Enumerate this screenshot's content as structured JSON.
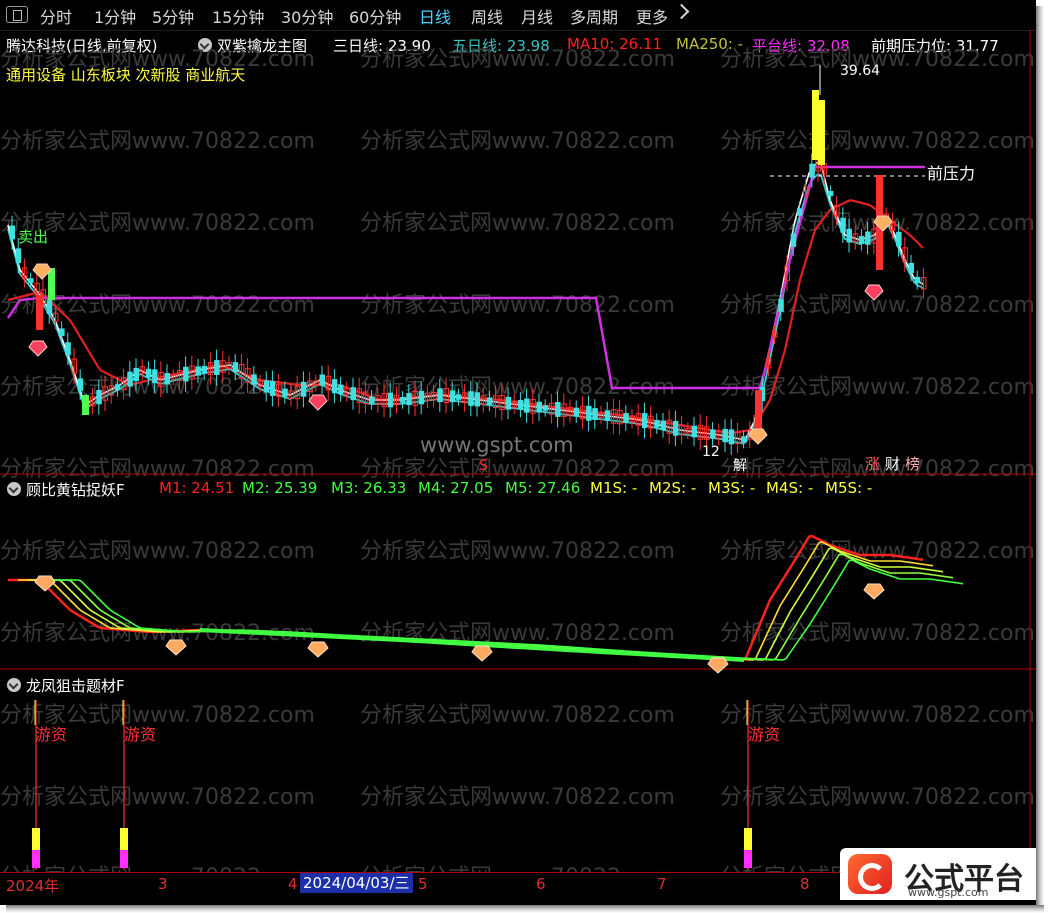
{
  "toolbar": {
    "items": [
      {
        "label": "分时"
      },
      {
        "label": "1分钟"
      },
      {
        "label": "5分钟"
      },
      {
        "label": "15分钟"
      },
      {
        "label": "30分钟"
      },
      {
        "label": "60分钟"
      },
      {
        "label": "日线"
      },
      {
        "label": "周线"
      },
      {
        "label": "月线"
      },
      {
        "label": "多周期"
      },
      {
        "label": "更多"
      }
    ],
    "active": "日线"
  },
  "main_panel": {
    "stock_title": "腾达科技(日线,前复权)",
    "indicator_name": "双紫擒龙主图",
    "legend": [
      {
        "label": "三日线: 23.90",
        "color": "#ffffff"
      },
      {
        "label": "五日线: 23.98",
        "color": "#40c0c0"
      },
      {
        "label": "MA10: 26.11",
        "color": "#ff2020"
      },
      {
        "label": "MA250: -",
        "color": "#c0c040"
      },
      {
        "label": "平台线: 32.08",
        "color": "#ff30ff"
      },
      {
        "label": "前期压力位: 31.77",
        "color": "#ffffff"
      }
    ],
    "tags": "通用设备 山东板块 次新股 商业航天",
    "annotations": {
      "high_price": "39.64",
      "low_price": "12",
      "pressure": "前压力",
      "sell": "卖出",
      "jie": "解",
      "s_mark": "S",
      "zhang": "涨",
      "cai": "财",
      "bang": "榜"
    }
  },
  "panel2": {
    "name": "顾比黄钻捉妖F",
    "legend": [
      {
        "label": "M1: 24.51",
        "color": "#ff2020"
      },
      {
        "label": "M2: 25.39",
        "color": "#40ff40"
      },
      {
        "label": "M3: 26.33",
        "color": "#40ff40"
      },
      {
        "label": "M4: 27.05",
        "color": "#40ff40"
      },
      {
        "label": "M5: 27.46",
        "color": "#40ff40"
      },
      {
        "label": "M1S: -",
        "color": "#ffff40"
      },
      {
        "label": "M2S: -",
        "color": "#ffff40"
      },
      {
        "label": "M3S: -",
        "color": "#ffff40"
      },
      {
        "label": "M4S: -",
        "color": "#ffff40"
      },
      {
        "label": "M5S: -",
        "color": "#ffff40"
      }
    ]
  },
  "panel3": {
    "name": "龙凤狙击题材F",
    "signal_label": "游资"
  },
  "date_axis": {
    "labels": [
      "2024年",
      "3",
      "4",
      "5",
      "6",
      "7",
      "8"
    ],
    "selected": "2024/04/03/三"
  },
  "watermarks": {
    "repeat_text": "分析家公式网www.70822.com",
    "site": "www.gspt.com"
  },
  "badge": {
    "text": "公式平台",
    "url": "www.gspt.com"
  },
  "colors": {
    "background": "#000000",
    "up": "#ff3030",
    "down": "#40e0e0",
    "ma10": "#e02020",
    "platform": "#d030e0",
    "grid": "#b00000",
    "selected_date": "#1c2fa8"
  }
}
